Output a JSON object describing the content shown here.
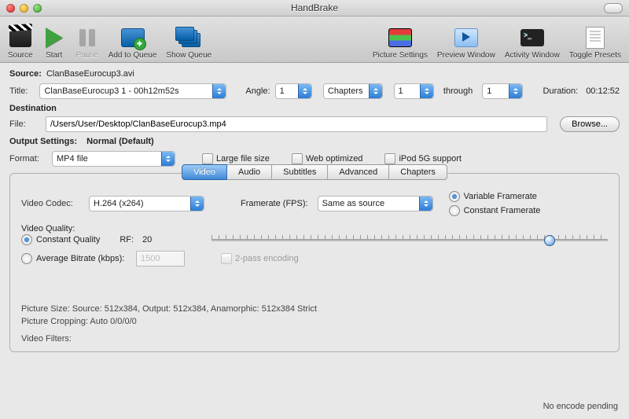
{
  "window": {
    "title": "HandBrake"
  },
  "toolbar": {
    "source": "Source",
    "start": "Start",
    "pause": "Pause",
    "add_to_queue": "Add to Queue",
    "show_queue": "Show Queue",
    "picture_settings": "Picture Settings",
    "preview_window": "Preview Window",
    "activity_window": "Activity Window",
    "toggle_presets": "Toggle Presets"
  },
  "source": {
    "label": "Source:",
    "value": "ClanBaseEurocup3.avi",
    "title_label": "Title:",
    "title_value": "ClanBaseEurocup3 1 - 00h12m52s",
    "angle_label": "Angle:",
    "angle_value": "1",
    "mode": "Chapters",
    "chapter_from": "1",
    "through_label": "through",
    "chapter_to": "1",
    "duration_label": "Duration:",
    "duration_value": "00:12:52"
  },
  "destination": {
    "heading": "Destination",
    "file_label": "File:",
    "file_value": "/Users/User/Desktop/ClanBaseEurocup3.mp4",
    "browse": "Browse..."
  },
  "output": {
    "heading": "Output Settings:",
    "preset": "Normal (Default)",
    "format_label": "Format:",
    "format_value": "MP4 file",
    "large_file": "Large file size",
    "web_optimized": "Web optimized",
    "ipod": "iPod 5G support"
  },
  "tabs": {
    "video": "Video",
    "audio": "Audio",
    "subtitles": "Subtitles",
    "advanced": "Advanced",
    "chapters": "Chapters"
  },
  "video": {
    "codec_label": "Video Codec:",
    "codec_value": "H.264 (x264)",
    "fps_label": "Framerate (FPS):",
    "fps_value": "Same as source",
    "vfr": "Variable Framerate",
    "cfr": "Constant Framerate",
    "quality_heading": "Video Quality:",
    "cq": "Constant Quality",
    "rf_label": "RF:",
    "rf_value": "20",
    "abr": "Average Bitrate (kbps):",
    "abr_value": "1500",
    "two_pass": "2-pass encoding"
  },
  "picture": {
    "size_line": "Picture Size: Source: 512x384, Output: 512x384, Anamorphic: 512x384 Strict",
    "crop_line": "Picture Cropping: Auto 0/0/0/0",
    "filters_line": "Video Filters:"
  },
  "status": "No encode pending"
}
